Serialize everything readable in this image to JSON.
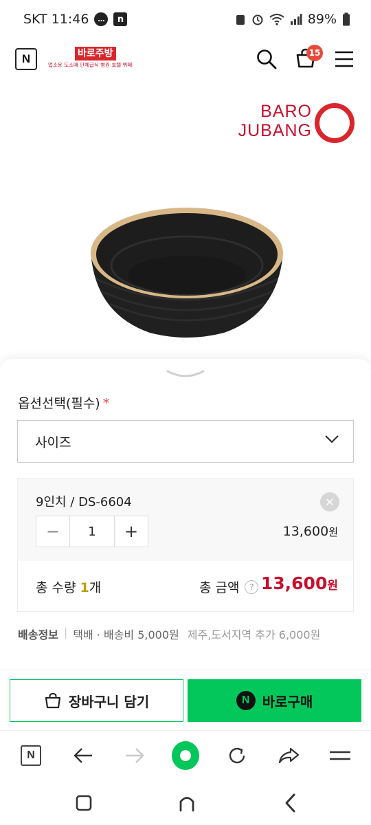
{
  "status_bar": {
    "carrier_time": "SKT 11:46",
    "battery": "89%",
    "notif_n": "n"
  },
  "header": {
    "logo_text": "N",
    "store_name": "바로주방",
    "store_tagline": "업소용 도소매 단체급식 병원 호텔 뷔페",
    "cart_count": "15"
  },
  "product": {
    "brand_line1": "BARO",
    "brand_line2": "JUBANG"
  },
  "options": {
    "title": "옵션선택(필수)",
    "required_mark": "*",
    "select_value": "사이즈"
  },
  "selected_item": {
    "name": "9인치 / DS-6604",
    "remove_label": "✕",
    "qty_minus": "−",
    "qty_value": "1",
    "qty_plus": "+",
    "price": "13,600",
    "price_unit": "원"
  },
  "totals": {
    "qty_label": "총 수량",
    "qty_value": "1",
    "qty_unit": "개",
    "amount_label": "총 금액",
    "help": "?",
    "amount": "13,600",
    "amount_unit": "원"
  },
  "shipping": {
    "label": "배송정보",
    "separator": "|",
    "method": "택배 · 배송비 5,000원",
    "extra": "제주,도서지역 추가 6,000원"
  },
  "actions": {
    "cart_label": "장바구니 담기",
    "buy_icon": "N",
    "buy_label": "바로구매"
  },
  "browser": {
    "n_label": "N"
  },
  "colors": {
    "brand_red": "#c8102e",
    "naver_green": "#03c75a"
  }
}
